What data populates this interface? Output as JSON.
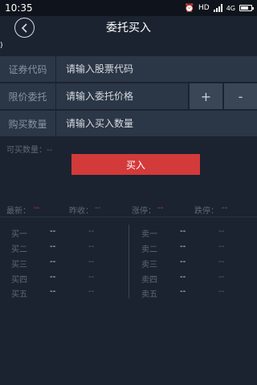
{
  "status_bar": {
    "time": "10:35",
    "network": "4G",
    "icons": [
      "alarm-icon",
      "hd-icon",
      "signal-icon",
      "network-4g-icon",
      "battery-icon"
    ]
  },
  "header": {
    "title": "委托买入",
    "back_icon": "chevron-left-icon"
  },
  "sub_mark": ")",
  "form": {
    "code": {
      "label": "证券代码",
      "placeholder": "请输入股票代码"
    },
    "price": {
      "label": "限价委托",
      "placeholder": "请输入委托价格",
      "plus": "+",
      "minus": "-"
    },
    "qty": {
      "label": "购买数量",
      "placeholder": "请输入买入数量"
    }
  },
  "available": "可买数量：--",
  "buy_button": "买入",
  "quote": {
    "latest_label": "最新：",
    "latest_value": "--",
    "prev_close_label": "昨收：",
    "prev_close_value": "--",
    "limit_up_label": "涨停：",
    "limit_up_value": "--",
    "limit_down_label": "跌停：",
    "limit_down_value": "--"
  },
  "order_book": {
    "bids": [
      {
        "label": "买一",
        "price": "--",
        "volume": "--"
      },
      {
        "label": "买二",
        "price": "--",
        "volume": "--"
      },
      {
        "label": "买三",
        "price": "--",
        "volume": "--"
      },
      {
        "label": "买四",
        "price": "--",
        "volume": "--"
      },
      {
        "label": "买五",
        "price": "--",
        "volume": "--"
      }
    ],
    "asks": [
      {
        "label": "卖一",
        "price": "--",
        "volume": "--"
      },
      {
        "label": "卖二",
        "price": "--",
        "volume": "--"
      },
      {
        "label": "卖三",
        "price": "--",
        "volume": "--"
      },
      {
        "label": "卖四",
        "price": "--",
        "volume": "--"
      },
      {
        "label": "卖五",
        "price": "--",
        "volume": "--"
      }
    ]
  },
  "colors": {
    "background": "#1b2330",
    "row": "#2b3646",
    "accent_red": "#d33a3a"
  }
}
